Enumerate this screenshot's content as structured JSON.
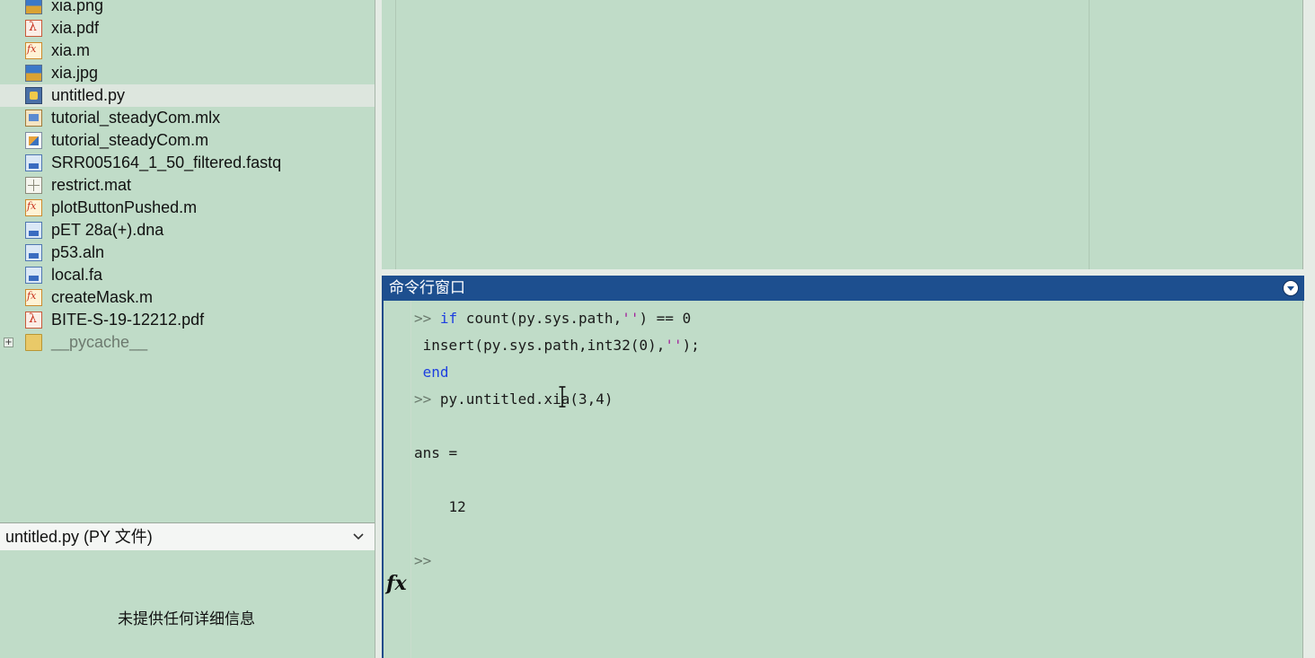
{
  "file_browser": {
    "files": [
      {
        "name": "xia.png",
        "icon": "image-file-icon",
        "kind": "img"
      },
      {
        "name": "xia.pdf",
        "icon": "pdf-file-icon",
        "kind": "pdf"
      },
      {
        "name": "xia.m",
        "icon": "matlab-script-icon",
        "kind": "m"
      },
      {
        "name": "xia.jpg",
        "icon": "image-file-icon",
        "kind": "img"
      },
      {
        "name": "untitled.py",
        "icon": "python-file-icon",
        "kind": "py",
        "selected": true
      },
      {
        "name": "tutorial_steadyCom.mlx",
        "icon": "live-script-icon",
        "kind": "mlx"
      },
      {
        "name": "tutorial_steadyCom.m",
        "icon": "matlab-script-icon",
        "kind": "doc"
      },
      {
        "name": "SRR005164_1_50_filtered.fastq",
        "icon": "data-file-icon",
        "kind": "data"
      },
      {
        "name": "restrict.mat",
        "icon": "mat-file-icon",
        "kind": "mat"
      },
      {
        "name": "plotButtonPushed.m",
        "icon": "matlab-script-icon",
        "kind": "m"
      },
      {
        "name": "pET 28a(+).dna",
        "icon": "data-file-icon",
        "kind": "data"
      },
      {
        "name": "p53.aln",
        "icon": "data-file-icon",
        "kind": "data"
      },
      {
        "name": "local.fa",
        "icon": "data-file-icon",
        "kind": "data"
      },
      {
        "name": "createMask.m",
        "icon": "matlab-script-icon",
        "kind": "m"
      },
      {
        "name": "BITE-S-19-12212.pdf",
        "icon": "pdf-file-icon",
        "kind": "pdf"
      },
      {
        "name": "__pycache__",
        "icon": "folder-icon",
        "kind": "folder",
        "expandable": true,
        "dim": true
      }
    ],
    "expander_symbol": "+"
  },
  "details": {
    "title": "untitled.py (PY 文件)",
    "empty_message": "未提供任何详细信息"
  },
  "command_window": {
    "title": "命令行窗口",
    "lines": [
      {
        "prompt": ">>",
        "segments": [
          {
            "t": " ",
            "c": ""
          },
          {
            "t": "if",
            "c": "kw"
          },
          {
            "t": " count(py.sys.path,",
            "c": ""
          },
          {
            "t": "''",
            "c": "str"
          },
          {
            "t": ") == 0",
            "c": ""
          }
        ]
      },
      {
        "prompt": "",
        "segments": [
          {
            "t": " insert(py.sys.path,int32(0),",
            "c": ""
          },
          {
            "t": "''",
            "c": "str"
          },
          {
            "t": ");",
            "c": ""
          }
        ]
      },
      {
        "prompt": "",
        "segments": [
          {
            "t": " ",
            "c": ""
          },
          {
            "t": "end",
            "c": "kw"
          }
        ]
      },
      {
        "prompt": ">>",
        "segments": [
          {
            "t": " py.untitled.xia(3,4)",
            "c": ""
          }
        ]
      },
      {
        "prompt": "",
        "segments": [
          {
            "t": "ans =",
            "c": ""
          }
        ]
      },
      {
        "prompt": "",
        "segments": [
          {
            "t": "    12",
            "c": ""
          }
        ]
      },
      {
        "prompt": ">>",
        "segments": []
      }
    ],
    "fx_label": "fx"
  },
  "colors": {
    "background": "#c0dcc8",
    "titlebar": "#1d4f8f",
    "keyword": "#1d3fe0",
    "string": "#a3249d"
  }
}
